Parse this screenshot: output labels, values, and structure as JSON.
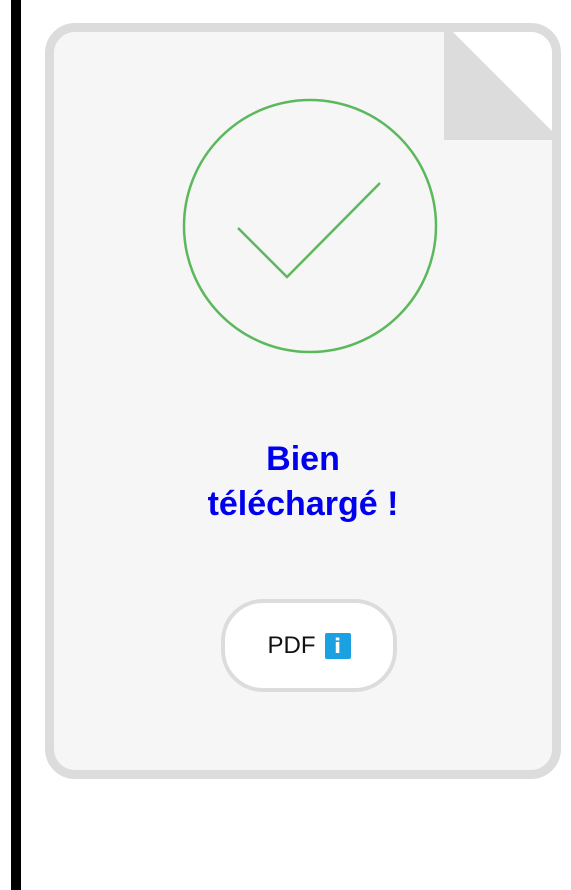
{
  "card": {
    "title_line1": "Bien",
    "title_line2": "téléchargé !",
    "badge_label": "PDF",
    "info_glyph": "i",
    "check_icon": "check-circle-icon"
  },
  "colors": {
    "title": "#0000ee",
    "check": "#5cb85c",
    "card_bg": "#f6f6f6",
    "card_border": "#dcdcdc",
    "info_icon": "#1ba1e2"
  }
}
